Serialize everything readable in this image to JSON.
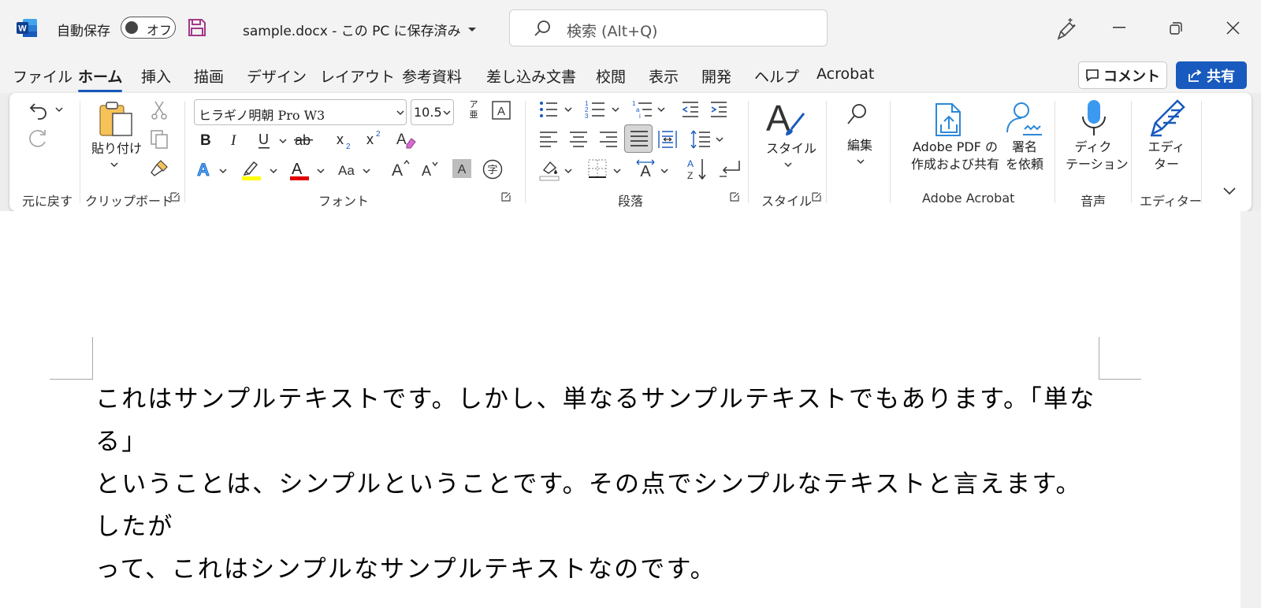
{
  "titlebar": {
    "autosave_label": "自動保存",
    "autosave_state": "オフ",
    "doc_title": "sample.docx - この PC に保存済み",
    "search_placeholder": "検索 (Alt+Q)"
  },
  "menu": {
    "tabs": [
      "ファイル",
      "ホーム",
      "挿入",
      "描画",
      "デザイン",
      "レイアウト",
      "参考資料",
      "差し込み文書",
      "校閲",
      "表示",
      "開発",
      "ヘルプ",
      "Acrobat"
    ],
    "active": "ホーム",
    "comment_label": "コメント",
    "share_label": "共有"
  },
  "ribbon": {
    "groups": {
      "undo": "元に戻す",
      "clipboard": "クリップボード",
      "font": "フォント",
      "paragraph": "段落",
      "styles": "スタイル",
      "adobe": "Adobe Acrobat",
      "voice": "音声",
      "editor": "エディター"
    },
    "paste_label": "貼り付け",
    "font_name": "ヒラギノ明朝 Pro W3",
    "font_size": "10.5",
    "ruby_top": "ア",
    "ruby_bottom": "亜",
    "styles_label": "スタイル",
    "edit_label": "編集",
    "adobe_pdf_line1": "Adobe PDF の",
    "adobe_pdf_line2": "作成および共有",
    "sign_line1": "署名",
    "sign_line2": "を依頼",
    "dictate_line1": "ディク",
    "dictate_line2": "テーション",
    "editor_line1": "エディ",
    "editor_line2": "ター",
    "phonetic_char": "字"
  },
  "document": {
    "lines": [
      "これはサンプルテキストです。しかし、単なるサンプルテキストでもあります。「単なる」",
      "ということは、シンプルということです。その点でシンプルなテキストと言えます。したが",
      "って、これはシンプルなサンプルテキストなのです。"
    ]
  },
  "colors": {
    "accent": "#185abd",
    "save_icon": "#a4388a",
    "highlight": "#ffff00",
    "font_color": "#e00000"
  }
}
